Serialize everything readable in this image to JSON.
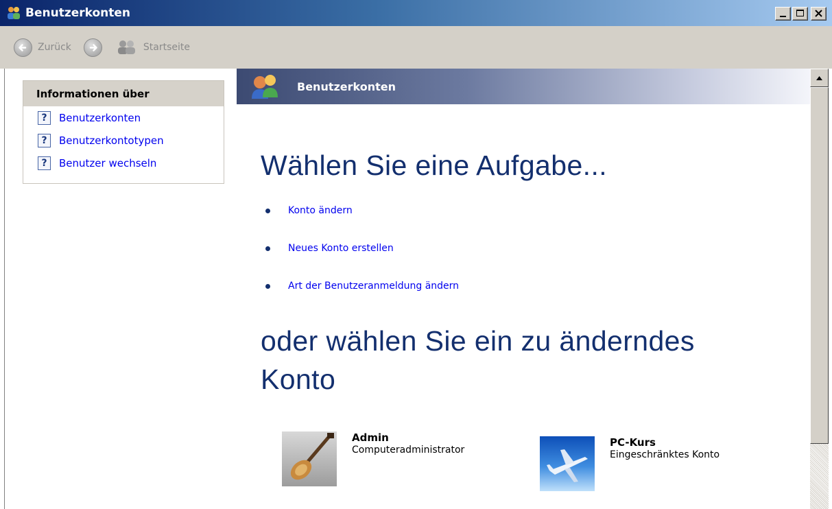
{
  "window": {
    "title": "Benutzerkonten",
    "colors": {
      "titlebar": "#0a246a",
      "link": "#0000ee",
      "heading": "#132f6e"
    }
  },
  "toolbar": {
    "back_label": "Zurück",
    "home_label": "Startseite"
  },
  "sidebar": {
    "header": "Informationen über",
    "items": [
      {
        "label": "Benutzerkonten",
        "icon": "help-icon"
      },
      {
        "label": "Benutzerkontotypen",
        "icon": "help-icon"
      },
      {
        "label": "Benutzer wechseln",
        "icon": "help-icon"
      }
    ]
  },
  "banner": {
    "title": "Benutzerkonten",
    "icon": "users-icon"
  },
  "main": {
    "heading_task": "Wählen Sie eine Aufgabe...",
    "tasks": [
      {
        "label": "Konto ändern"
      },
      {
        "label": "Neues Konto erstellen"
      },
      {
        "label": "Art der Benutzeranmeldung ändern"
      }
    ],
    "heading_account": "oder wählen Sie ein zu änderndes Konto",
    "accounts": [
      {
        "name": "Admin",
        "type": "Computeradministrator",
        "picture": "guitar-picture"
      },
      {
        "name": "PC-Kurs",
        "type": "Eingeschränktes Konto",
        "picture": "airplane-picture"
      }
    ]
  }
}
